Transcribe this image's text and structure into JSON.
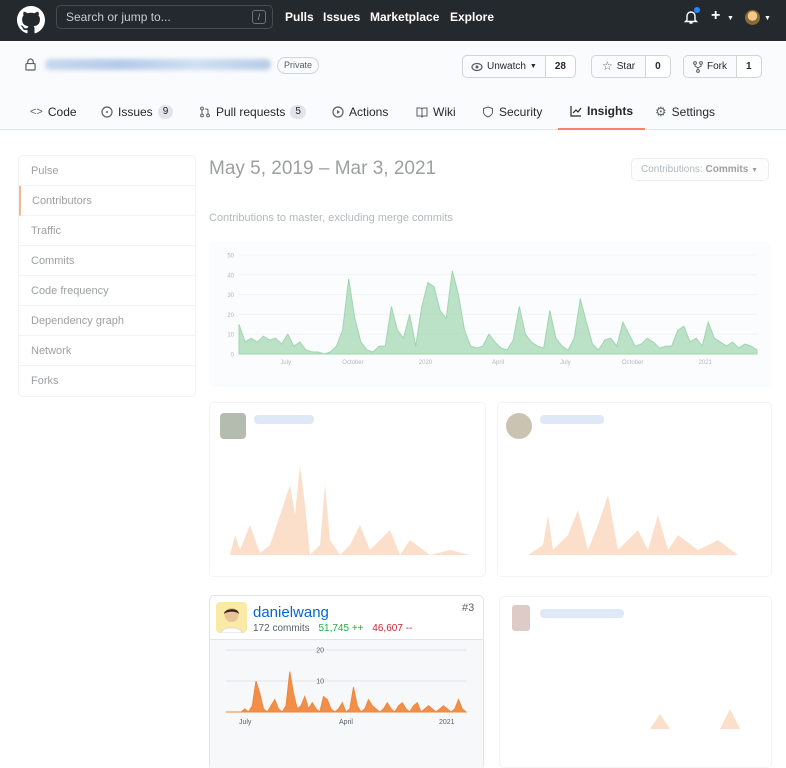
{
  "topbar": {
    "search_placeholder": "Search or jump to...",
    "slash_key": "/",
    "nav": [
      "Pulls",
      "Issues",
      "Marketplace",
      "Explore"
    ],
    "brand_color": "#24292e"
  },
  "repo": {
    "visibility": "Private",
    "watch": {
      "label": "Unwatch",
      "count": "28"
    },
    "star": {
      "label": "Star",
      "count": "0"
    },
    "fork": {
      "label": "Fork",
      "count": "1"
    }
  },
  "tabs": [
    {
      "label": "Code",
      "icon": "code-icon"
    },
    {
      "label": "Issues",
      "count": "9",
      "icon": "issue-icon"
    },
    {
      "label": "Pull requests",
      "count": "5",
      "icon": "pull-request-icon"
    },
    {
      "label": "Actions",
      "icon": "play-icon"
    },
    {
      "label": "Wiki",
      "icon": "book-icon"
    },
    {
      "label": "Security",
      "icon": "shield-icon"
    },
    {
      "label": "Insights",
      "icon": "graph-icon",
      "selected": true
    },
    {
      "label": "Settings",
      "icon": "gear-icon"
    }
  ],
  "sidebar": {
    "items": [
      "Pulse",
      "Contributors",
      "Traffic",
      "Commits",
      "Code frequency",
      "Dependency graph",
      "Network",
      "Forks"
    ],
    "selected": "Contributors"
  },
  "main": {
    "date_range": "May 5, 2019 – Mar 3, 2021",
    "contributions_label": "Contributions:",
    "contributions_value": "Commits",
    "subtitle": "Contributions to master, excluding merge commits"
  },
  "chart_data": [
    {
      "type": "area",
      "color": "#2da44e",
      "x_ticks": [
        "July",
        "October",
        "2020",
        "April",
        "July",
        "October",
        "2021"
      ],
      "y_ticks": [
        0,
        10,
        20,
        30,
        40,
        50
      ],
      "ylim": [
        0,
        50
      ],
      "values": [
        15,
        6,
        8,
        6,
        9,
        7,
        8,
        5,
        10,
        4,
        6,
        2,
        1,
        1,
        0,
        1,
        4,
        12,
        38,
        18,
        6,
        2,
        1,
        4,
        4,
        24,
        12,
        8,
        20,
        4,
        24,
        36,
        34,
        22,
        18,
        42,
        30,
        12,
        4,
        3,
        4,
        10,
        6,
        3,
        2,
        7,
        24,
        10,
        6,
        4,
        3,
        22,
        8,
        4,
        2,
        8,
        28,
        16,
        5,
        2,
        7,
        8,
        4,
        16,
        10,
        4,
        5,
        8,
        6,
        3,
        4,
        4,
        12,
        14,
        6,
        8,
        4,
        16,
        8,
        6,
        4,
        6,
        3,
        5,
        4,
        2
      ]
    },
    {
      "type": "area",
      "color": "#f0883e",
      "x_ticks": [
        "July",
        "April",
        "2021"
      ],
      "y_ticks": [
        10,
        20
      ],
      "ylim": [
        0,
        20
      ],
      "values": [
        0,
        0,
        0,
        0,
        0,
        1,
        0,
        2,
        10,
        6,
        1,
        0,
        2,
        4,
        1,
        0,
        2,
        13,
        6,
        1,
        2,
        5,
        1,
        3,
        1,
        0,
        5,
        4,
        1,
        0,
        1,
        3,
        0,
        1,
        8,
        2,
        0,
        1,
        4,
        2,
        1,
        0,
        1,
        3,
        1,
        0,
        2,
        3,
        1,
        0,
        2,
        3,
        0,
        1,
        2,
        1,
        0,
        1,
        2,
        1,
        0,
        1,
        4,
        1,
        0
      ]
    }
  ],
  "highlighted_contributor": {
    "name": "danielwang",
    "commits": "172 commits",
    "additions": "51,745 ++",
    "deletions": "46,607 --",
    "rank": "#3"
  }
}
